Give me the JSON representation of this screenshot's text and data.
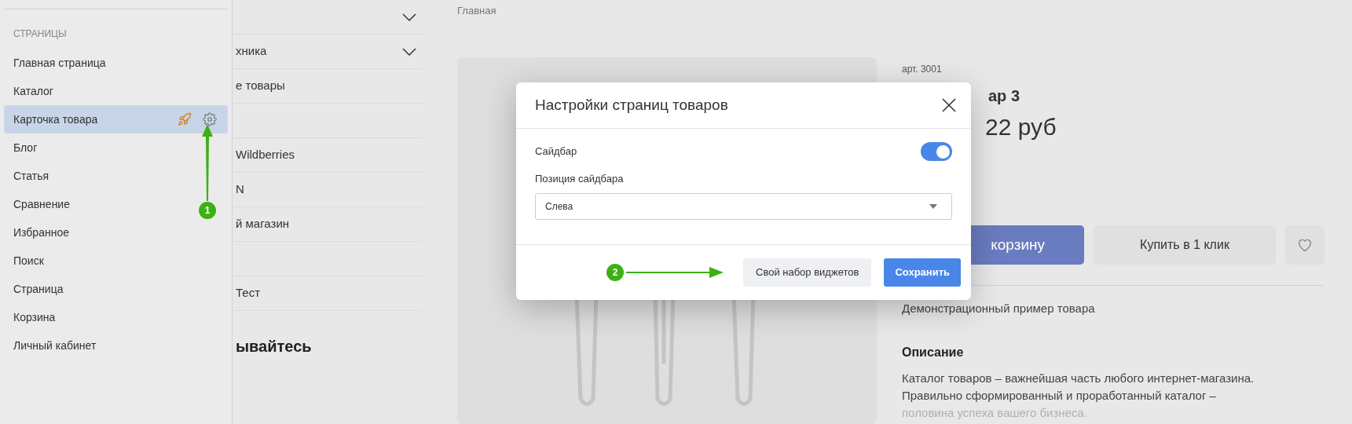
{
  "sidebar": {
    "section_title": "СТРАНИЦЫ",
    "items": [
      {
        "label": "Главная страница",
        "selected": false
      },
      {
        "label": "Каталог",
        "selected": false
      },
      {
        "label": "Карточка товара",
        "selected": true
      },
      {
        "label": "Блог",
        "selected": false
      },
      {
        "label": "Статья",
        "selected": false
      },
      {
        "label": "Сравнение",
        "selected": false
      },
      {
        "label": "Избранное",
        "selected": false
      },
      {
        "label": "Поиск",
        "selected": false
      },
      {
        "label": "Страница",
        "selected": false
      },
      {
        "label": "Корзина",
        "selected": false
      },
      {
        "label": "Личный кабинет",
        "selected": false
      }
    ]
  },
  "menu": {
    "items": [
      {
        "expandable": true
      },
      {
        "label": "хника",
        "expandable": true
      },
      {
        "label": "е товары",
        "expandable": false
      },
      {
        "expandable": false
      },
      {
        "label": "Wildberries",
        "expandable": false
      },
      {
        "label": "N",
        "expandable": false
      },
      {
        "label": "й магазин",
        "expandable": false
      },
      {
        "expandable": false
      },
      {
        "label": "Тест",
        "expandable": false
      }
    ],
    "heading": "ывайтесь"
  },
  "breadcrumb": "Главная",
  "product": {
    "sku": "арт. 3001",
    "title": "ар 3",
    "price": "22 руб",
    "cart_button": "корзину",
    "buy_button": "Купить в 1 клик",
    "summary": "Демонстрационный пример товара",
    "description_title": "Описание",
    "description": [
      "Каталог товаров – важнейшая часть любого интернет-магазина.",
      "Правильно сформированный и проработанный каталог –",
      "половина успеха вашего бизнеса."
    ]
  },
  "dialog": {
    "title": "Настройки страниц товаров",
    "sidebar_toggle": {
      "label": "Сайдбар",
      "on": true
    },
    "position_select": {
      "label": "Позиция сайдбара",
      "value": "Слева"
    },
    "buttons": [
      {
        "label": "Свой набор виджетов",
        "kind": "secondary"
      },
      {
        "label": "Сохранить",
        "kind": "primary"
      }
    ]
  },
  "annotations": [
    {
      "number": "1"
    },
    {
      "number": "2"
    }
  ]
}
